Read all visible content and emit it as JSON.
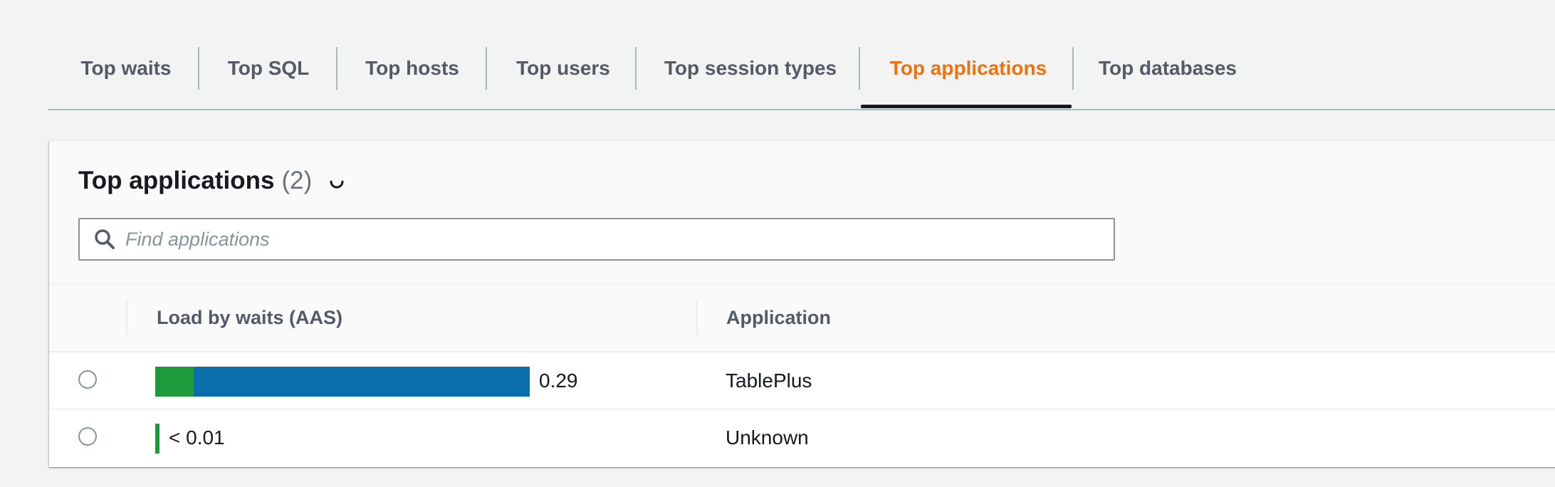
{
  "tabs": [
    {
      "label": "Top waits"
    },
    {
      "label": "Top SQL"
    },
    {
      "label": "Top hosts"
    },
    {
      "label": "Top users"
    },
    {
      "label": "Top session types"
    },
    {
      "label": "Top applications"
    },
    {
      "label": "Top databases"
    }
  ],
  "active_tab": "Top applications",
  "panel": {
    "title": "Top applications",
    "count": "(2)",
    "search_placeholder": "Find applications"
  },
  "table": {
    "columns": [
      "Load by waits (AAS)",
      "Application"
    ],
    "rows": [
      {
        "load_label": "0.29",
        "application": "TablePlus",
        "load_segments": [
          {
            "color": "#1d9a3a",
            "value": 0.03
          },
          {
            "color": "#0a6eab",
            "value": 0.26
          }
        ]
      },
      {
        "load_label": "< 0.01",
        "application": "Unknown",
        "load_segments": [
          {
            "color": "#1d9a3a",
            "value": 0.002
          }
        ]
      }
    ],
    "load_max": 0.29
  },
  "colors": {
    "accent": "#ec7211",
    "wait_cpu": "#1d9a3a",
    "wait_io": "#0a6eab"
  }
}
